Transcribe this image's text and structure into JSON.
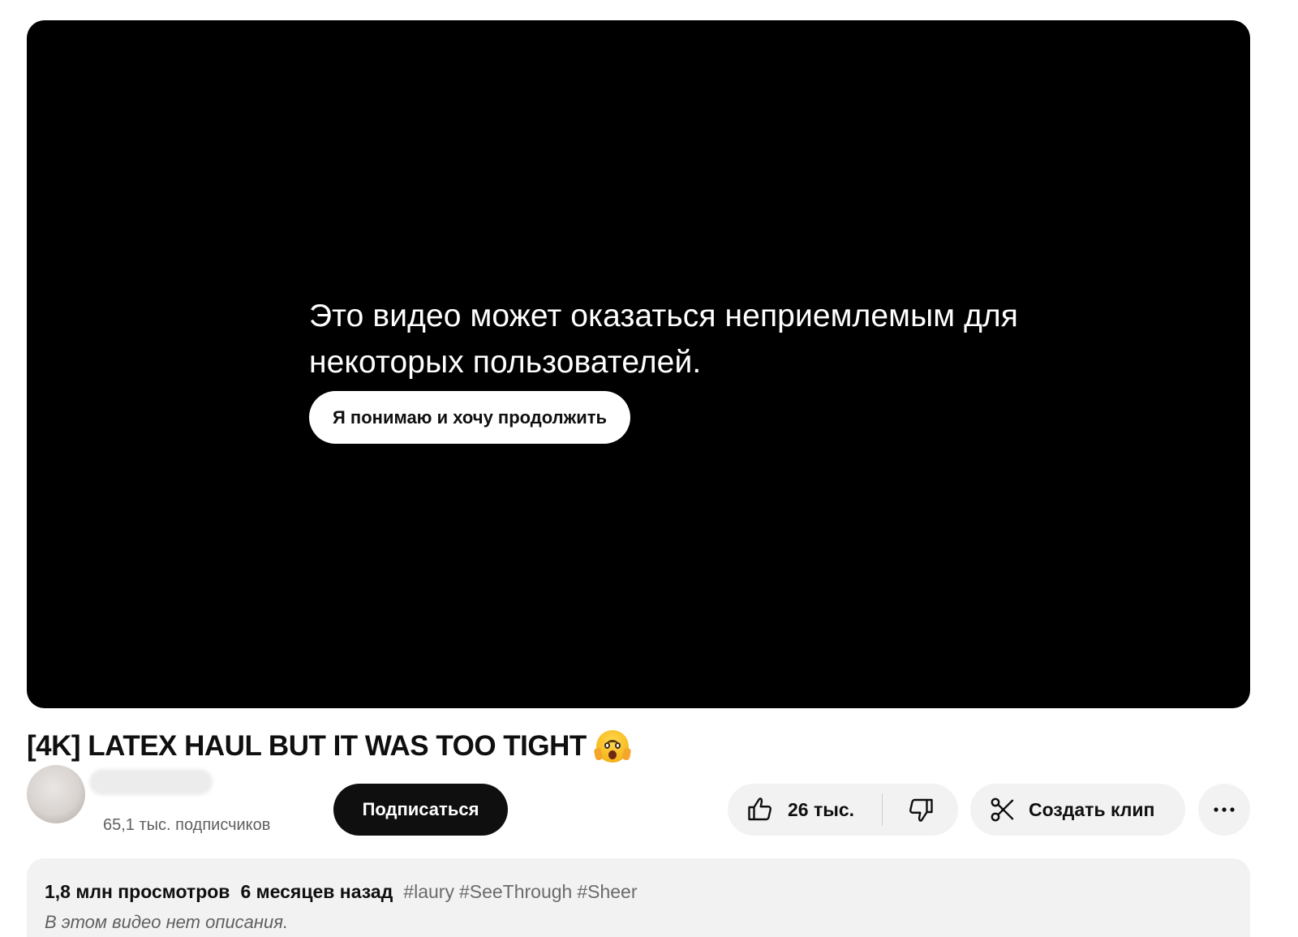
{
  "player": {
    "warning_text": "Это видео может оказаться неприемлемым для некоторых пользователей.",
    "continue_label": "Я понимаю и хочу продолжить"
  },
  "video": {
    "title": "[4K] LATEX HAUL BUT IT WAS TOO TIGHT",
    "title_emoji": "face-screaming-in-fear"
  },
  "channel": {
    "subscriber_count": "65,1 тыс. подписчиков"
  },
  "actions": {
    "subscribe_label": "Подписаться",
    "like_count": "26 тыс.",
    "clip_label": "Создать клип",
    "icons": {
      "like": "thumbs-up-icon",
      "dislike": "thumbs-down-icon",
      "clip": "scissors-icon",
      "more": "more-horizontal-icon"
    }
  },
  "description": {
    "views": "1,8 млн просмотров",
    "published": "6 месяцев назад",
    "hashtags": [
      "#laury",
      "#SeeThrough",
      "#Sheer"
    ],
    "empty_text": "В этом видео нет описания."
  },
  "colors": {
    "player_bg": "#000000",
    "button_dark": "#0f0f0f",
    "chip_bg": "#f2f2f2",
    "secondary_text": "#606060"
  }
}
